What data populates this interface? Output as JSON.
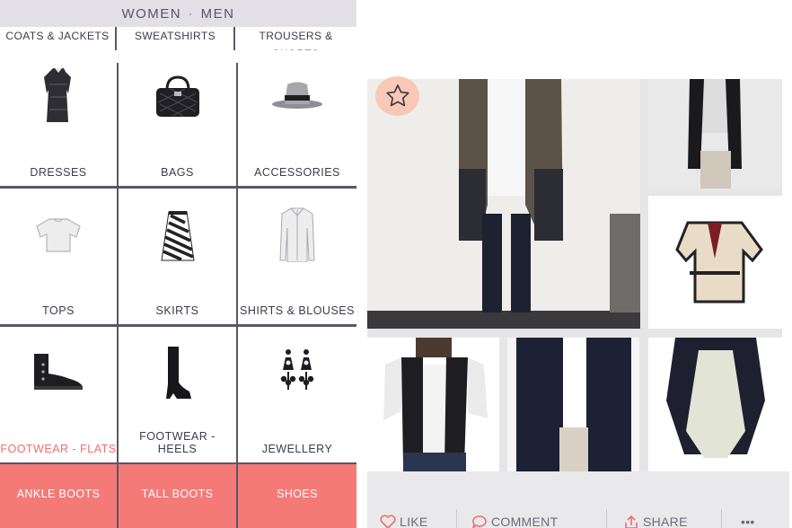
{
  "header": {
    "women": "WOMEN",
    "sep": "·",
    "men": "MEN"
  },
  "subcategories": [
    "COATS & JACKETS",
    "SWEATSHIRTS",
    "TROUSERS & SHORTS"
  ],
  "categories": [
    {
      "label": "DRESSES",
      "icon": "dress-icon",
      "active": false
    },
    {
      "label": "BAGS",
      "icon": "bag-icon",
      "active": false
    },
    {
      "label": "ACCESSORIES",
      "icon": "hat-icon",
      "active": false
    },
    {
      "label": "TOPS",
      "icon": "top-icon",
      "active": false
    },
    {
      "label": "SKIRTS",
      "icon": "skirt-icon",
      "active": false
    },
    {
      "label": "SHIRTS & BLOUSES",
      "icon": "shirt-icon",
      "active": false
    },
    {
      "label": "FOOTWEAR - FLATS",
      "icon": "ankle-boot-icon",
      "active": true
    },
    {
      "label": "FOOTWEAR - HEELS",
      "icon": "tall-boot-icon",
      "active": false
    },
    {
      "label": "JEWELLERY",
      "icon": "earrings-icon",
      "active": false
    }
  ],
  "subfilters": [
    "ANKLE BOOTS",
    "TALL BOOTS",
    "SHOES"
  ],
  "actions": {
    "like": "LIKE",
    "comment": "COMMENT",
    "share": "SHARE",
    "more": "•••"
  },
  "colors": {
    "accent": "#f47a78",
    "active_text": "#f26c6c",
    "divider": "#5a5668",
    "star_bg": "#f7c9b6"
  }
}
